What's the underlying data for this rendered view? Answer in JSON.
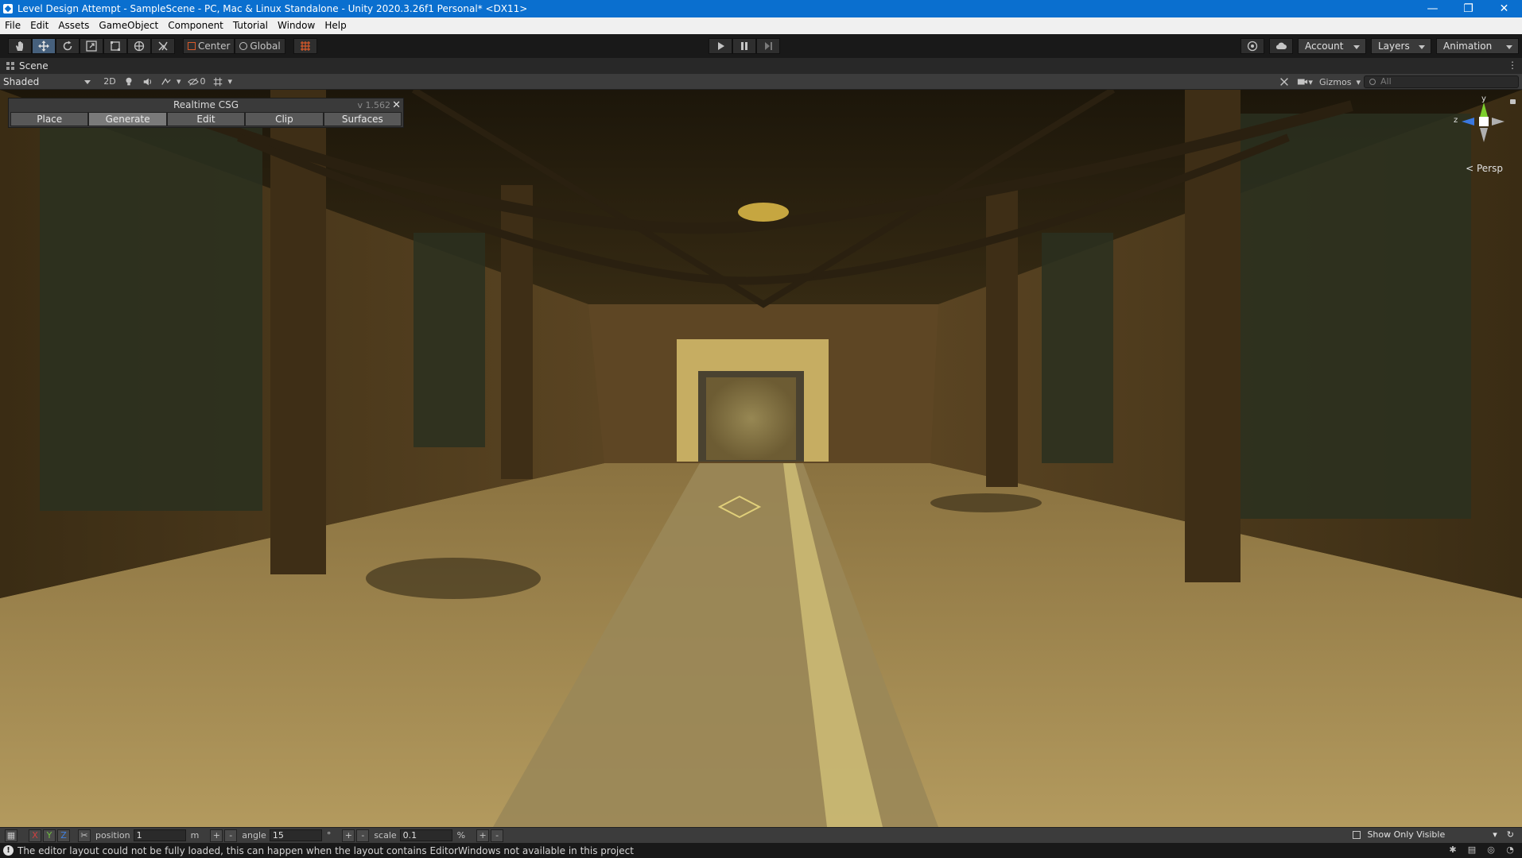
{
  "window": {
    "title": "Level Design Attempt - SampleScene - PC, Mac & Linux Standalone - Unity 2020.3.26f1 Personal* <DX11>",
    "controls": [
      "—",
      "❐",
      "✕"
    ]
  },
  "menu": [
    "File",
    "Edit",
    "Assets",
    "GameObject",
    "Component",
    "Tutorial",
    "Window",
    "Help"
  ],
  "toolbar": {
    "tools": [
      "hand-tool",
      "move-tool",
      "rotate-tool",
      "scale-tool",
      "rect-tool",
      "transform-tool",
      "custom-tool"
    ],
    "active_tool": "move-tool",
    "pivot_mode": "Center",
    "pivot_rotation": "Global",
    "account": "Account",
    "layers": "Layers",
    "layout": "Animation"
  },
  "scene": {
    "tab_label": "Scene",
    "shading_mode": "Shaded",
    "mode_2d": "2D",
    "hidden_count": "0",
    "gizmos_label": "Gizmos",
    "search_placeholder": "All",
    "persp_label": "< Persp",
    "gizmo_axes": {
      "y": "y",
      "z": "z"
    }
  },
  "csg": {
    "title": "Realtime CSG",
    "version": "v 1.562",
    "tabs": [
      "Place",
      "Generate",
      "Edit",
      "Clip",
      "Surfaces"
    ],
    "active_tab": "Generate"
  },
  "bottom_bar": {
    "axes": [
      "X",
      "Y",
      "Z"
    ],
    "position_label": "position",
    "position_value": "1",
    "position_unit": "m",
    "angle_label": "angle",
    "angle_value": "15",
    "angle_unit": "°",
    "scale_label": "scale",
    "scale_value": "0.1",
    "scale_unit": "%",
    "show_only_visible": "Show Only Visible"
  },
  "status": {
    "message": "The editor layout could not be fully loaded, this can happen when the layout contains EditorWindows not available in this project"
  },
  "colors": {
    "title_bar": "#0a6fcf",
    "editor_bg": "#191919",
    "active_tool": "#46607c",
    "gizmo_x": "#e03c3c",
    "gizmo_y": "#7ccf2c",
    "gizmo_z": "#3a78e0"
  }
}
